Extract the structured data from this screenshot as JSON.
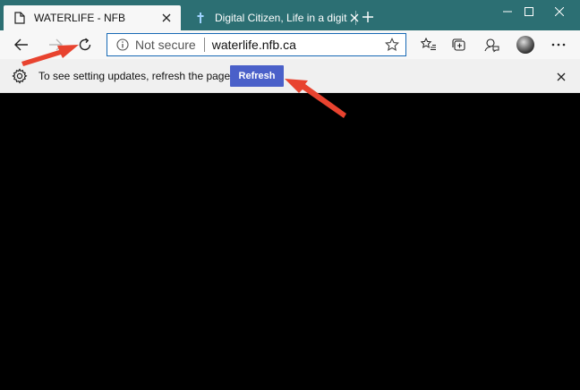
{
  "tabs": [
    {
      "title": "WATERLIFE - NFB",
      "icon": "page-icon",
      "active": true
    },
    {
      "title": "Digital Citizen, Life in a digital wo",
      "icon": "cross-favicon-icon",
      "active": false
    }
  ],
  "toolbar": {
    "back_icon": "back-arrow-icon",
    "forward_icon": "forward-arrow-icon",
    "refresh_icon": "refresh-icon"
  },
  "address": {
    "security_label": "Not secure",
    "url": "waterlife.nfb.ca"
  },
  "infobar": {
    "message": "To see setting updates, refresh the page",
    "button_label": "Refresh"
  },
  "colors": {
    "titlebar": "#2c6f73",
    "accent_button": "#4a60c9",
    "annotation_arrow": "#e8432f"
  }
}
